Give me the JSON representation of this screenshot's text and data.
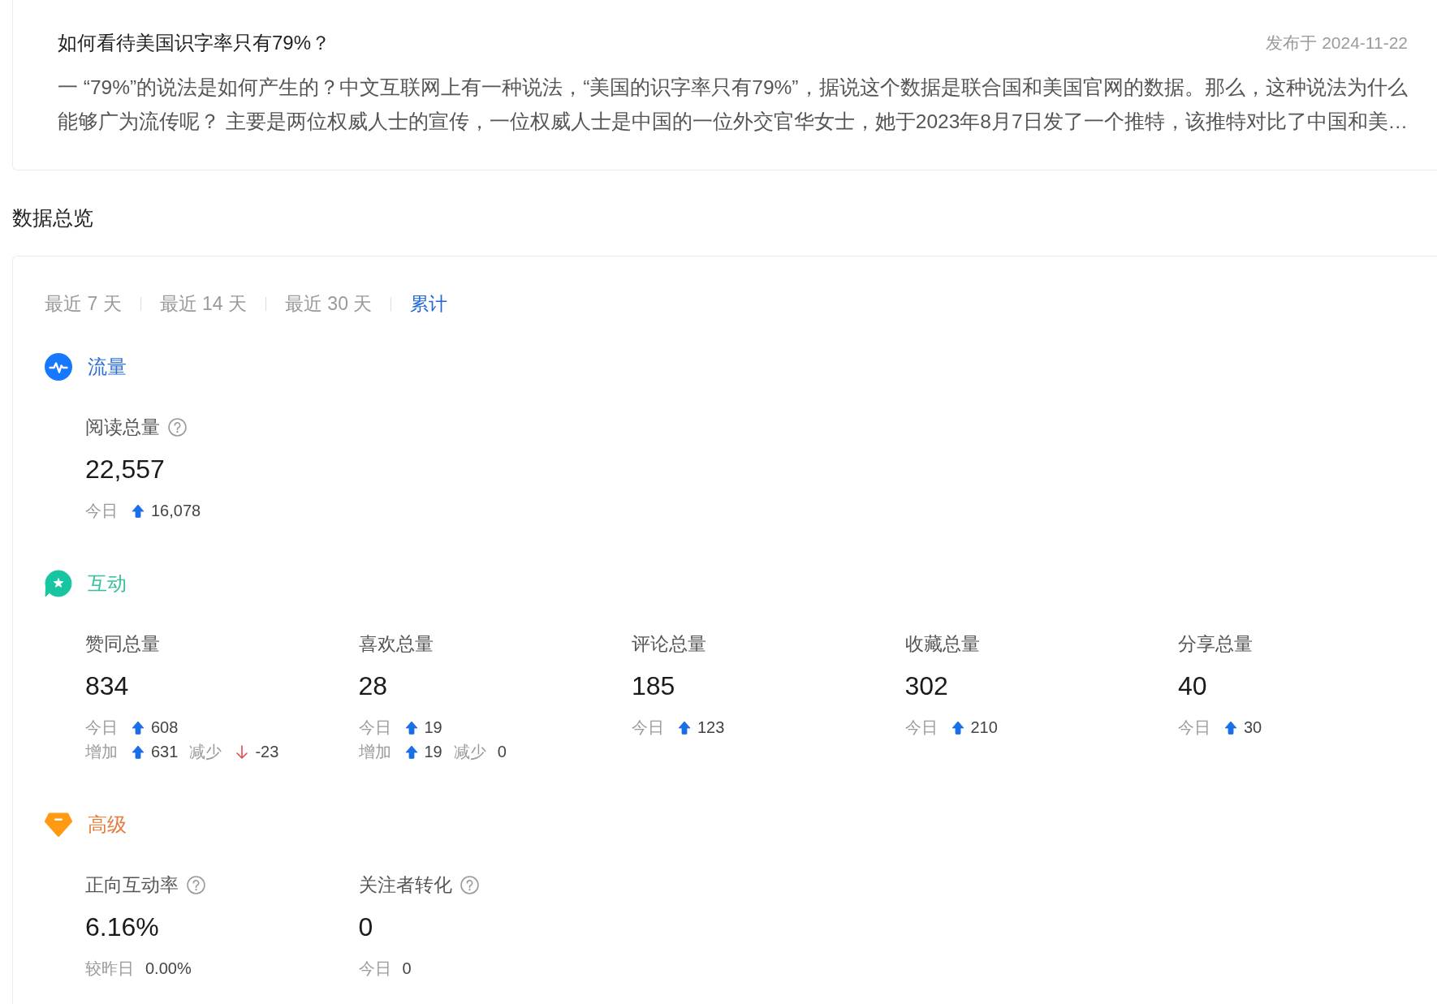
{
  "article": {
    "title": "如何看待美国识字率只有79%？",
    "published": "发布于 2024-11-22",
    "excerpt": "一 “79%”的说法是如何产生的？中文互联网上有一种说法，“美国的识字率只有79%”，据说这个数据是联合国和美国官网的数据。那么，这种说法为什么能够广为流传呢？ 主要是两位权威人士的宣传，一位权威人士是中国的一位外交官华女士，她于2023年8月7日发了一个推特，该推特对比了中国和美…"
  },
  "overview": {
    "heading": "数据总览",
    "tabs": [
      {
        "label": "最近 7 天",
        "selected": false
      },
      {
        "label": "最近 14 天",
        "selected": false
      },
      {
        "label": "最近 30 天",
        "selected": false
      },
      {
        "label": "累计",
        "selected": true
      }
    ],
    "sections": [
      {
        "kind": "traffic",
        "title": "流量",
        "metrics": [
          {
            "label": "阅读总量",
            "help": true,
            "value": "22,557",
            "rows": [
              [
                {
                  "kind": "up",
                  "caption": "今日",
                  "value": "16,078"
                }
              ]
            ]
          }
        ]
      },
      {
        "kind": "interaction",
        "title": "互动",
        "metrics": [
          {
            "label": "赞同总量",
            "help": false,
            "value": "834",
            "rows": [
              [
                {
                  "kind": "up",
                  "caption": "今日",
                  "value": "608"
                }
              ],
              [
                {
                  "kind": "up",
                  "caption": "增加",
                  "value": "631"
                },
                {
                  "kind": "down",
                  "caption": "减少",
                  "value": "-23"
                }
              ]
            ]
          },
          {
            "label": "喜欢总量",
            "help": false,
            "value": "28",
            "rows": [
              [
                {
                  "kind": "up",
                  "caption": "今日",
                  "value": "19"
                }
              ],
              [
                {
                  "kind": "up",
                  "caption": "增加",
                  "value": "19"
                },
                {
                  "kind": "plain",
                  "caption": "减少",
                  "value": "0"
                }
              ]
            ]
          },
          {
            "label": "评论总量",
            "help": false,
            "value": "185",
            "rows": [
              [
                {
                  "kind": "up",
                  "caption": "今日",
                  "value": "123"
                }
              ]
            ]
          },
          {
            "label": "收藏总量",
            "help": false,
            "value": "302",
            "rows": [
              [
                {
                  "kind": "up",
                  "caption": "今日",
                  "value": "210"
                }
              ]
            ]
          },
          {
            "label": "分享总量",
            "help": false,
            "value": "40",
            "rows": [
              [
                {
                  "kind": "up",
                  "caption": "今日",
                  "value": "30"
                }
              ]
            ]
          }
        ]
      },
      {
        "kind": "advanced",
        "title": "高级",
        "metrics": [
          {
            "label": "正向互动率",
            "help": true,
            "value": "6.16%",
            "rows": [
              [
                {
                  "kind": "plain",
                  "caption": "较昨日",
                  "value": "0.00%"
                }
              ]
            ]
          },
          {
            "label": "关注者转化",
            "help": true,
            "value": "0",
            "rows": [
              [
                {
                  "kind": "plain",
                  "caption": "今日",
                  "value": "0"
                }
              ]
            ]
          }
        ]
      }
    ]
  }
}
